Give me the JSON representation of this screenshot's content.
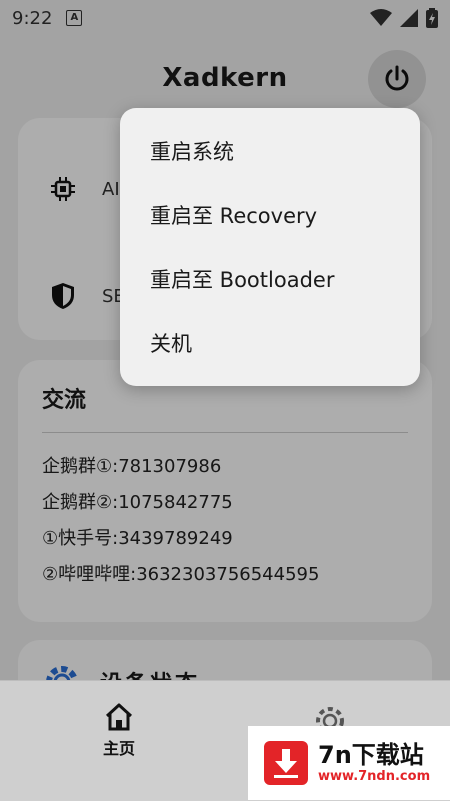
{
  "status_bar": {
    "time": "9:22",
    "app_indicator": "A",
    "icons": [
      "wifi-icon",
      "signal-icon",
      "battery-icon"
    ]
  },
  "app_bar": {
    "title": "Xadkern",
    "power_icon": "power-icon"
  },
  "info_card": {
    "rows": [
      {
        "icon": "chip-icon",
        "label": "AI"
      },
      {
        "icon": "shield-icon",
        "label": "SE"
      }
    ]
  },
  "social_card": {
    "title": "交流",
    "lines": [
      "企鹅群①:781307986",
      "企鹅群②:1075842775",
      "①快手号:3439789249",
      "②哔哩哔哩:3632303756544595"
    ]
  },
  "device_card": {
    "title": "设备状态",
    "icon": "gear-icon"
  },
  "power_menu": {
    "items": [
      "重启系统",
      "重启至 Recovery",
      "重启至 Bootloader",
      "关机"
    ]
  },
  "bottom_nav": {
    "home_label": "主页",
    "home_icon": "home-icon",
    "settings_icon": "settings-icon"
  },
  "watermark": {
    "title": "7n下载站",
    "url": "www.7ndn.com",
    "brand_color": "#e32428"
  }
}
